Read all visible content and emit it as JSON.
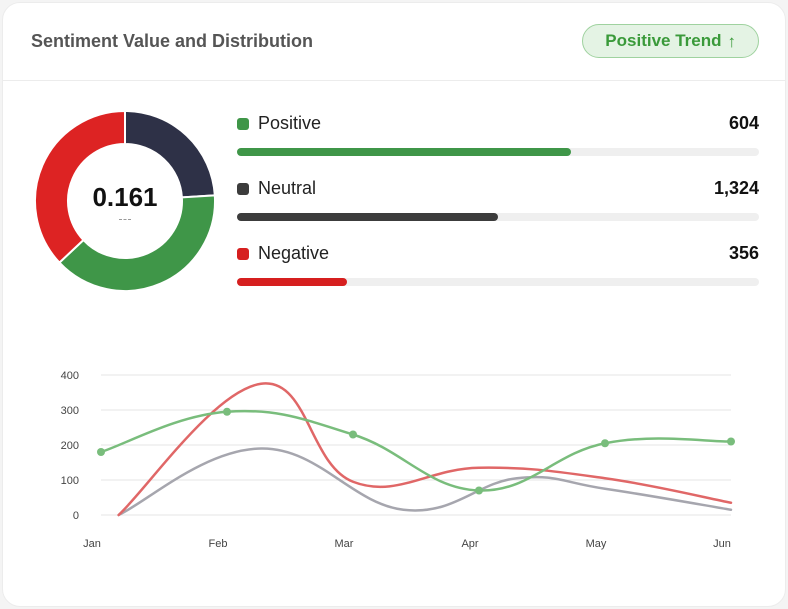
{
  "header": {
    "title": "Sentiment Value and Distribution",
    "badge_label": "Positive Trend",
    "badge_icon": "arrow-up-icon"
  },
  "donut": {
    "center_value": "0.161"
  },
  "distribution": [
    {
      "label": "Positive",
      "value_text": "604",
      "value": 604,
      "color": "#3f9648"
    },
    {
      "label": "Neutral",
      "value_text": "1,324",
      "value": 1324,
      "color": "#3c3c3c"
    },
    {
      "label": "Negative",
      "value_text": "356",
      "value": 356,
      "color": "#d61f1f"
    }
  ],
  "bar_fill_fractions": [
    0.64,
    0.5,
    0.21
  ],
  "chart_data": [
    {
      "type": "pie",
      "variant": "donut",
      "categories": [
        "Neutral",
        "Positive",
        "Negative"
      ],
      "values": [
        24,
        39,
        37
      ],
      "colors": [
        "#2e3147",
        "#3f9648",
        "#dd2323"
      ]
    },
    {
      "type": "line",
      "categories": [
        "Jan",
        "Feb",
        "Mar",
        "Apr",
        "May",
        "Jun"
      ],
      "ylim": [
        0,
        400
      ],
      "yticks": [
        0,
        100,
        200,
        300,
        400
      ],
      "grid": true,
      "series": [
        {
          "color": "#79bd7c",
          "markers": true,
          "x": [
            0,
            1,
            2,
            3,
            4,
            5
          ],
          "values": [
            180,
            295,
            230,
            70,
            205,
            210
          ]
        },
        {
          "color": "#e06767",
          "markers": false,
          "x": [
            0.14,
            1.27,
            2.0,
            3.0,
            4.0,
            5.0
          ],
          "values": [
            0,
            375,
            95,
            135,
            105,
            35
          ]
        },
        {
          "color": "#a6a6ae",
          "markers": false,
          "x": [
            0.14,
            1.27,
            2.4,
            3.3,
            4.0,
            5.0
          ],
          "values": [
            0,
            190,
            15,
            105,
            75,
            15
          ]
        }
      ]
    }
  ]
}
